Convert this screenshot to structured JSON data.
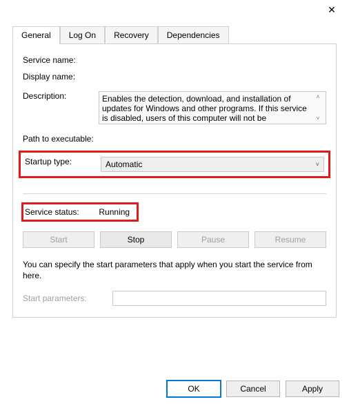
{
  "titlebar": {
    "close_glyph": "✕"
  },
  "tabs": {
    "general": "General",
    "logon": "Log On",
    "recovery": "Recovery",
    "dependencies": "Dependencies"
  },
  "labels": {
    "service_name": "Service name:",
    "display_name": "Display name:",
    "description": "Description:",
    "path": "Path to executable:",
    "startup_type": "Startup type:",
    "service_status": "Service status:",
    "start_params": "Start parameters:"
  },
  "values": {
    "service_name": "",
    "display_name": "",
    "description": "Enables the detection, download, and installation of updates for Windows and other programs. If this service is disabled, users of this computer will not be",
    "path": "",
    "startup_type": "Automatic",
    "service_status": "Running",
    "start_params": ""
  },
  "buttons": {
    "start": "Start",
    "stop": "Stop",
    "pause": "Pause",
    "resume": "Resume",
    "ok": "OK",
    "cancel": "Cancel",
    "apply": "Apply"
  },
  "hint": "You can specify the start parameters that apply when you start the service from here.",
  "scroll": {
    "up": "˄",
    "down": "˅"
  },
  "chevron": "˅"
}
